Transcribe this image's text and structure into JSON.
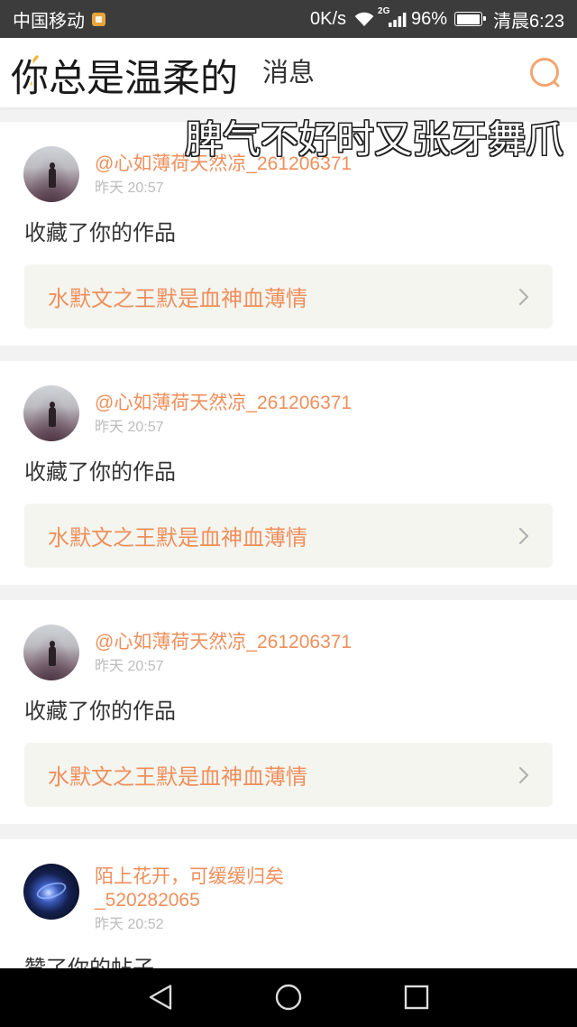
{
  "status_bar": {
    "carrier": "中国移动",
    "net_speed": "0K/s",
    "network_type": "2G",
    "battery_percent": "96%",
    "battery_level": 0.96,
    "time": "清晨6:23",
    "icons": [
      "app-notification-icon",
      "wifi-icon",
      "signal-icon",
      "battery-icon"
    ]
  },
  "header": {
    "title": "消息",
    "icons": [
      "back-arrow-icon",
      "search-icon"
    ]
  },
  "overlay_captions": {
    "line_1": "你总是温柔的",
    "line_2": "脾气不好时又张牙舞爪"
  },
  "messages": [
    {
      "user": "@心如薄荷天然凉_261206371",
      "time": "昨天 20:57",
      "action": "收藏了你的作品",
      "work_title": "水默文之王默是血神血薄情"
    },
    {
      "user": "@心如薄荷天然凉_261206371",
      "time": "昨天 20:57",
      "action": "收藏了你的作品",
      "work_title": "水默文之王默是血神血薄情"
    },
    {
      "user": "@心如薄荷天然凉_261206371",
      "time": "昨天 20:57",
      "action": "收藏了你的作品",
      "work_title": "水默文之王默是血神血薄情"
    },
    {
      "user": "陌上花开，可缓缓归矣_520282065",
      "time": "昨天 20:52",
      "action": "赞了你的帖子"
    }
  ],
  "nav_bar": {
    "icons": [
      "nav-back-icon",
      "nav-home-icon",
      "nav-recents-icon"
    ]
  },
  "colors": {
    "accent": "#ef8f5c",
    "icon_accent": "#f4a56f",
    "back_icon": "#f1b33c",
    "status_bar_bg": "#3c3c3c",
    "page_bg": "#f2f2f2",
    "card_bg": "#ffffff",
    "work_box_bg": "#f5f5f0",
    "body_text": "#333333",
    "muted_text": "#bcbcbc",
    "nav_bar_bg": "#000000"
  }
}
